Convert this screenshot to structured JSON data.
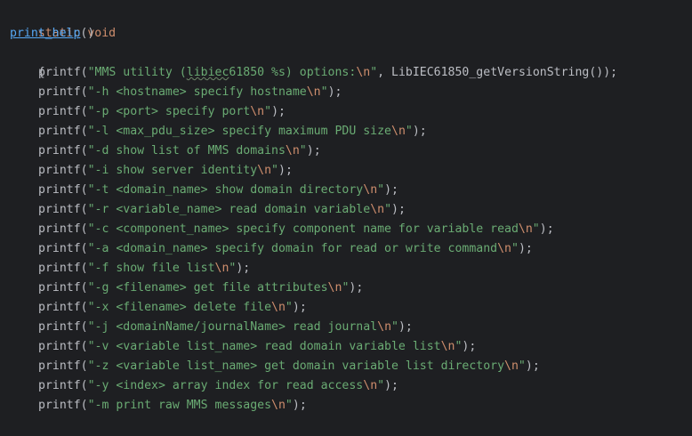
{
  "code": {
    "decl_keywords": "static void",
    "function_name": "print_help",
    "function_parens": "()",
    "open_brace": "{",
    "close_brace": "}",
    "call_name": "printf",
    "newline_escape": "\\n",
    "first_line": {
      "str_before_typo": "\"MMS utility (",
      "typo_word": "libiec",
      "str_after_typo": "61850 %s) options:",
      "str_close": "\"",
      "args": ", LibIEC61850_getVersionString());"
    },
    "help_lines": [
      {
        "text": "\"-h <hostname> specify hostname"
      },
      {
        "text": "\"-p <port> specify port"
      },
      {
        "text": "\"-l <max_pdu_size> specify maximum PDU size"
      },
      {
        "text": "\"-d show list of MMS domains"
      },
      {
        "text": "\"-i show server identity"
      },
      {
        "text": "\"-t <domain_name> show domain directory"
      },
      {
        "text": "\"-r <variable_name> read domain variable"
      },
      {
        "text": "\"-c <component_name> specify component name for variable read"
      },
      {
        "text": "\"-a <domain_name> specify domain for read or write command"
      },
      {
        "text": "\"-f show file list"
      },
      {
        "text": "\"-g <filename> get file attributes"
      },
      {
        "text": "\"-x <filename> delete file"
      },
      {
        "text": "\"-j <domainName/journalName> read journal"
      },
      {
        "text": "\"-v <variable list_name> read domain variable list"
      },
      {
        "text": "\"-z <variable list_name> get domain variable list directory"
      },
      {
        "text": "\"-y <index> array index for read access"
      },
      {
        "text": "\"-m print raw MMS messages"
      }
    ],
    "line_end": "\");"
  },
  "colors": {
    "background": "#1e1f22",
    "keyword": "#cf8e6d",
    "function": "#56a8f5",
    "string": "#6aab73",
    "text": "#bcbec4"
  }
}
